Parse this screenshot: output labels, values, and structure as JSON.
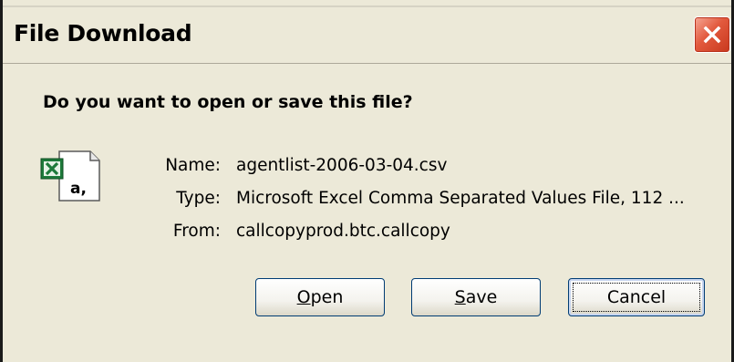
{
  "dialog": {
    "title": "File Download",
    "prompt": "Do you want to open or save this file?"
  },
  "file": {
    "icon": "excel-csv-file-icon",
    "name_label": "Name:",
    "name_value": "agentlist-2006-03-04.csv",
    "type_label": "Type:",
    "type_value": "Microsoft Excel Comma Separated Values File, 112 ...",
    "from_label": "From:",
    "from_value": "callcopyprod.btc.callcopy",
    "icon_text": "a,"
  },
  "buttons": {
    "open_mnemonic": "O",
    "open_rest": "pen",
    "save_mnemonic": "S",
    "save_rest": "ave",
    "cancel_label": "Cancel"
  },
  "colors": {
    "dialog_bg": "#ece9d8",
    "close_button": "#e2593d",
    "excel_green": "#1d7a3a"
  }
}
